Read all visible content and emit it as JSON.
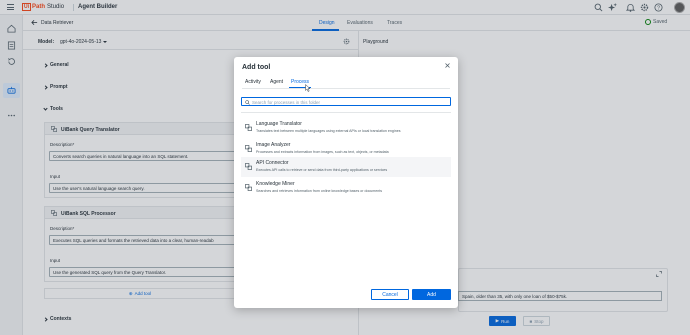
{
  "topbar": {
    "logo_ui": "Ui",
    "logo_path": "Path",
    "logo_studio": "Studio",
    "product": "Agent Builder",
    "icons": [
      "menu-icon",
      "search-icon",
      "sparkle-icon",
      "notification-icon",
      "settings-icon",
      "help-icon",
      "avatar"
    ]
  },
  "rail": {
    "icons": [
      "home-icon",
      "projects-icon",
      "history-icon",
      "agent-icon",
      "more-icon"
    ]
  },
  "header": {
    "title": "Data Retriever",
    "tabs": [
      "Design",
      "Evaluations",
      "Traces"
    ],
    "active_tab": "Design",
    "saved_label": "Saved"
  },
  "design": {
    "model_label": "Model:",
    "model_value": "gpt-4o-2024-05-13",
    "sections": {
      "general": "General",
      "prompt": "Prompt",
      "tools": "Tools",
      "contexts": "Contexts"
    },
    "tools": [
      {
        "name": "UiBank Query Translator",
        "description_label": "Description*",
        "description": "Converts search queries in natural language into an SQL statement.",
        "input_label": "Input",
        "input": "Use the user's natural language search query."
      },
      {
        "name": "UiBank SQL Processor",
        "description_label": "Description*",
        "description": "Executes SQL queries and formats the retrieved data into a clear, human-readab",
        "input_label": "Input",
        "input": "Use the generated SQL query from the Query Translator."
      }
    ],
    "add_tool_label": "Add tool"
  },
  "playground": {
    "title": "Playground",
    "input_value": "Spain, older than 35, with only one loan of $50-$75k.",
    "run_label": "Run",
    "stop_label": "Stop"
  },
  "modal": {
    "title": "Add tool",
    "tabs": [
      "Activity",
      "Agent",
      "Process"
    ],
    "active_tab": "Process",
    "search_placeholder": "Search for processes in this folder",
    "items": [
      {
        "name": "Language Translator",
        "description": "Translates text between multiple languages using external APIs or local translation engines"
      },
      {
        "name": "Image Analyzer",
        "description": "Processes and extracts information from images, such as text, objects, or metadata"
      },
      {
        "name": "API Connector",
        "description": "Executes API calls to retrieve or send data from third-party applications or services"
      },
      {
        "name": "Knowledge Miner",
        "description": "Searches and retrieves information from online knowledge bases or documents"
      }
    ],
    "hovered_item": "API Connector",
    "cancel_label": "Cancel",
    "add_label": "Add"
  },
  "colors": {
    "accent": "#0067df",
    "brand": "#fa4616",
    "saved_green": "#038108"
  }
}
